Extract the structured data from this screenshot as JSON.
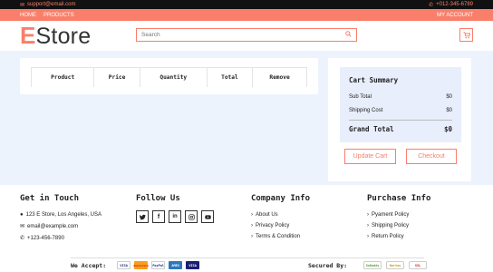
{
  "topbar": {
    "email": "support@email.com",
    "phone": "+012-345-6789"
  },
  "nav": {
    "links": [
      "HOME",
      "PRODUCTS"
    ],
    "account": "MY ACCOUNT"
  },
  "logo": {
    "first_letter": "E",
    "rest": "Store"
  },
  "search": {
    "placeholder": "Search"
  },
  "cart_table": {
    "headers": [
      "Product",
      "Price",
      "Quantity",
      "Total",
      "Remove"
    ]
  },
  "summary": {
    "title": "Cart Summary",
    "sub_total_label": "Sub Total",
    "sub_total_value": "$0",
    "shipping_label": "Shipping Cost",
    "shipping_value": "$0",
    "grand_total_label": "Grand Total",
    "grand_total_value": "$0",
    "update_label": "Update Cart",
    "checkout_label": "Checkout"
  },
  "footer": {
    "contact": {
      "title": "Get in Touch",
      "address": "123 E Store, Los Angeles, USA",
      "email": "email@example.com",
      "phone": "+123-456-7890"
    },
    "follow": {
      "title": "Follow Us",
      "icons": [
        "twitter-icon",
        "facebook-icon",
        "linkedin-icon",
        "instagram-icon",
        "youtube-icon"
      ]
    },
    "company": {
      "title": "Company Info",
      "links": [
        "About Us",
        "Privacy Policy",
        "Terms & Condition"
      ]
    },
    "purchase": {
      "title": "Purchase Info",
      "links": [
        "Pyament Policy",
        "Shipping Policy",
        "Return Policy"
      ]
    },
    "accept_label": "We Accept:",
    "cards": [
      "VISA",
      "MasterCard",
      "PayPal",
      "AMEX",
      "VISA"
    ],
    "secured_label": "Secured By:",
    "badges": [
      "GoDaddy",
      "Norton",
      "SSL"
    ]
  },
  "colors": {
    "accent": "#fa7f6a",
    "main_bg": "#edf3fd",
    "summary_box": "#e8eefb"
  }
}
